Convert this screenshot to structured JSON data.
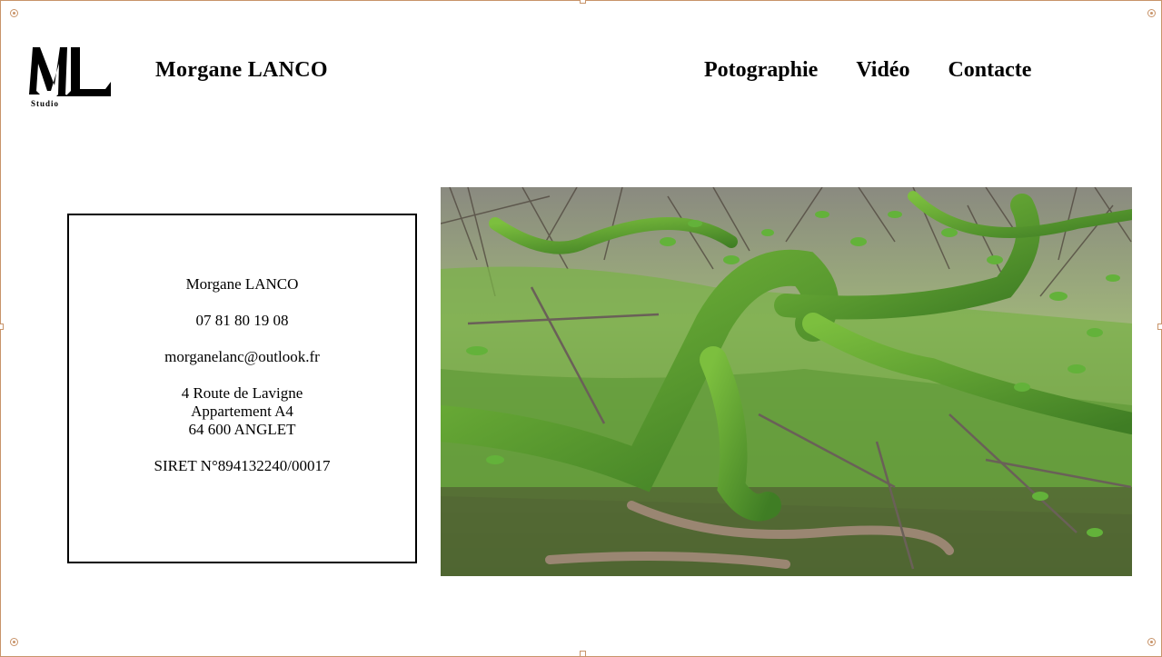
{
  "logo": {
    "monogram": "ML",
    "subtitle": "Studio"
  },
  "header": {
    "title": "Morgane LANCO"
  },
  "nav": {
    "items": [
      "Potographie",
      "Vidéo",
      "Contacte"
    ]
  },
  "contact": {
    "name": "Morgane LANCO",
    "phone": "07 81 80 19 08",
    "email": "morganelanc@outlook.fr",
    "address_line1": "4 Route de Lavigne",
    "address_line2": "Appartement A4",
    "address_line3": "64 600 ANGLET",
    "siret": "SIRET N°894132240/00017"
  },
  "colors": {
    "frame": "#c8946a",
    "moss": "#6aa23c",
    "leaf": "#4e9a2e"
  }
}
